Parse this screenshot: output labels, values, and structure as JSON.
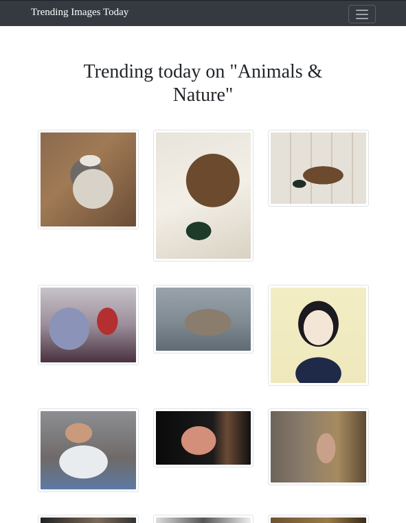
{
  "navbar": {
    "brand": "Trending Images Today",
    "toggler_icon": "hamburger-menu-icon"
  },
  "page": {
    "title": "Trending today on \"Animals & Nature\""
  },
  "images": [
    {
      "subject": "husky-dog"
    },
    {
      "subject": "pheasant"
    },
    {
      "subject": "pheasant-on-tiles"
    },
    {
      "subject": "blurred-crowd"
    },
    {
      "subject": "elephant-seal"
    },
    {
      "subject": "anime-girl-with-camera"
    },
    {
      "subject": "man-with-money"
    },
    {
      "subject": "man-webcam"
    },
    {
      "subject": "man-with-sword"
    },
    {
      "subject": "image-10"
    },
    {
      "subject": "image-11"
    },
    {
      "subject": "image-12"
    }
  ]
}
